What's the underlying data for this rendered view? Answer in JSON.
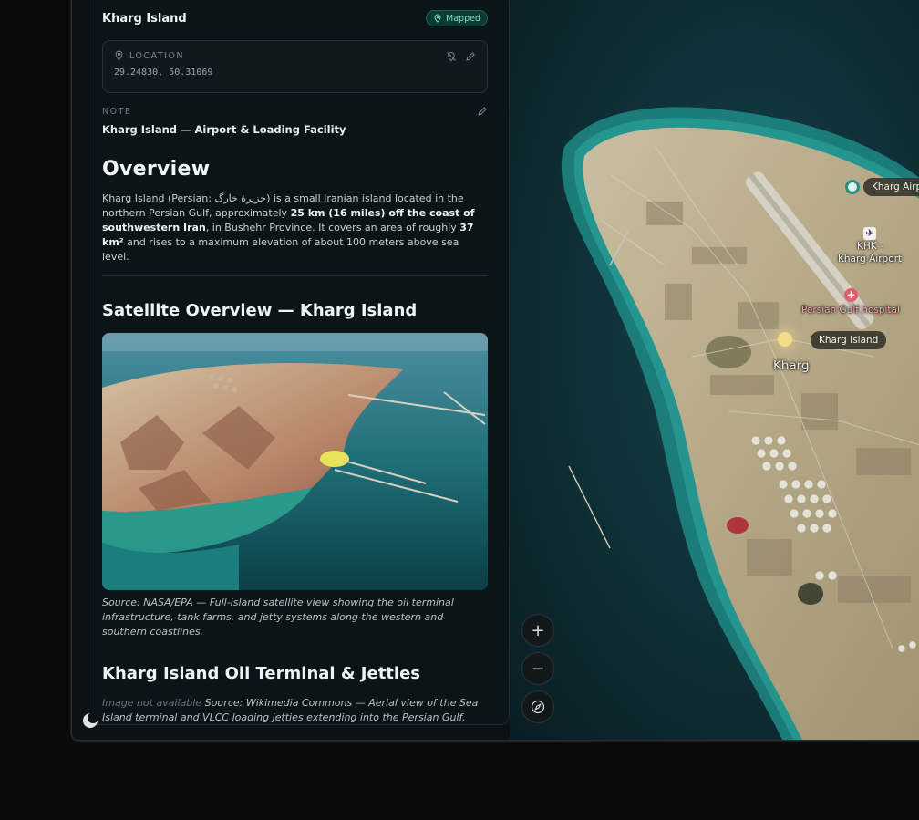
{
  "panel": {
    "place_name": "Kharg Island",
    "badge": "Mapped",
    "location": {
      "label": "LOCATION",
      "coords": "29.24830, 50.31069"
    },
    "note": {
      "label": "NOTE",
      "text": "Kharg Island — Airport & Loading Facility"
    },
    "overview": {
      "heading": "Overview",
      "p_a": "Kharg Island (Persian: جزیرهٔ خارگ) is a small Iranian island located in the northern Persian Gulf, approximately ",
      "p_b1": "25 km (16 miles) off the coast of southwestern Iran",
      "p_c": ", in Bushehr Province. It covers an area of roughly ",
      "p_b2": "37 km²",
      "p_d": " and rises to a maximum elevation of about 100 meters above sea level."
    },
    "satellite": {
      "heading": "Satellite Overview — Kharg Island",
      "caption": "Source: NASA/EPA — Full-island satellite view showing the oil terminal infrastructure, tank farms, and jetty systems along the western and southern coastlines."
    },
    "terminal": {
      "heading": "Kharg Island Oil Terminal & Jetties",
      "unavailable": "Image not available",
      "caption": " Source: Wikimedia Commons — Aerial view of the Sea Island terminal and VLCC loading jetties extending into the Persian Gulf."
    }
  },
  "map": {
    "labels": {
      "airport_pill": "Kharg Airp",
      "khk": "KHK -",
      "airport": "Kharg Airport",
      "hospital": "Persian Gulf hospital",
      "island_pill": "Kharg Island",
      "town": "Kharg"
    },
    "controls": {
      "zoom_in": "+",
      "zoom_out": "−"
    }
  }
}
